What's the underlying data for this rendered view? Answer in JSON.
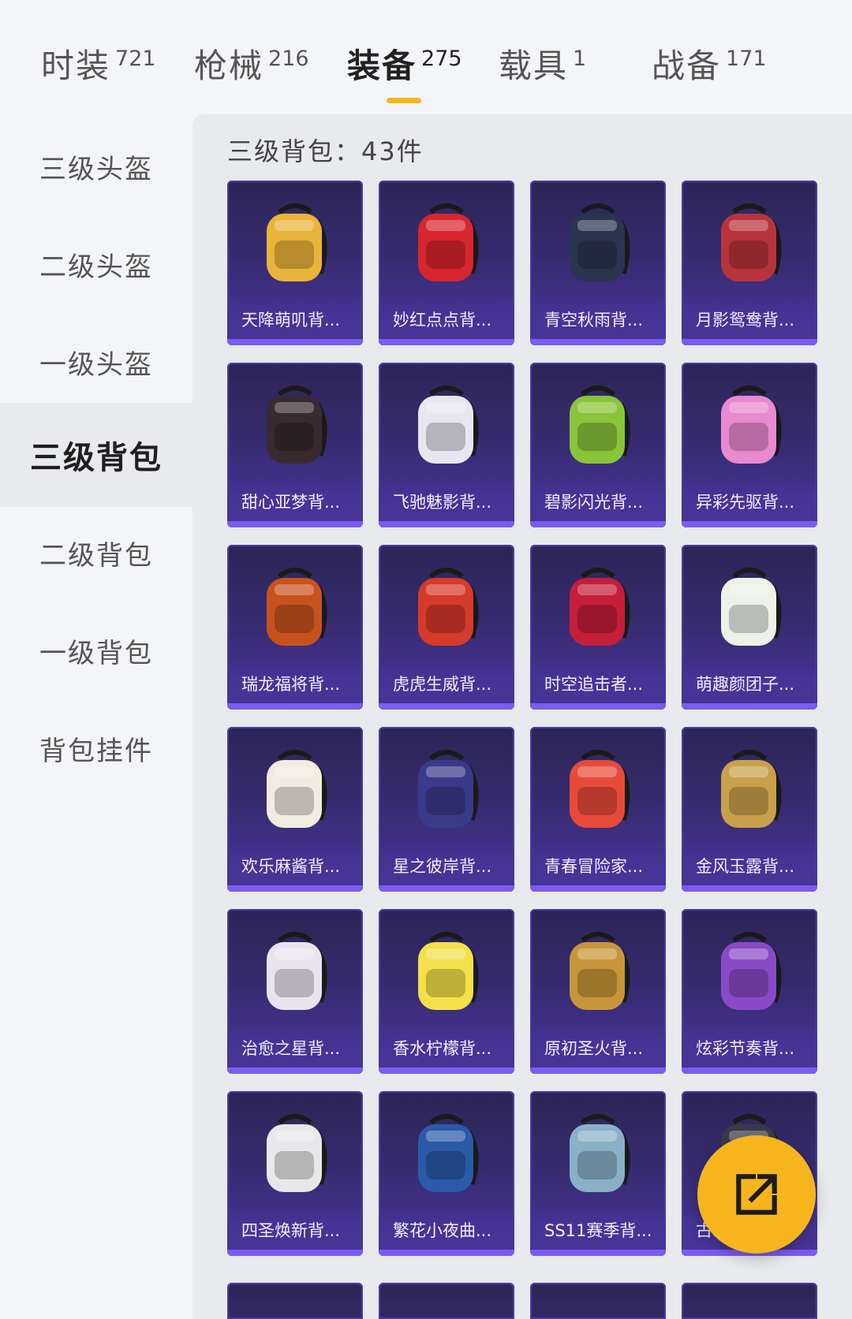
{
  "tabs": [
    {
      "label": "时装",
      "count": "721"
    },
    {
      "label": "枪械",
      "count": "216"
    },
    {
      "label": "装备",
      "count": "275",
      "active": true
    },
    {
      "label": "载具",
      "count": "1"
    },
    {
      "label": "战备",
      "count": "171"
    }
  ],
  "sidebar": {
    "items": [
      {
        "label": "三级头盔"
      },
      {
        "label": "二级头盔"
      },
      {
        "label": "一级头盔"
      },
      {
        "label": "三级背包",
        "active": true
      },
      {
        "label": "二级背包"
      },
      {
        "label": "一级背包"
      },
      {
        "label": "背包挂件"
      }
    ]
  },
  "main": {
    "section_title": "三级背包：43件",
    "items": [
      {
        "name": "天降萌叽背...",
        "icon": "backpack-icon",
        "color": "#e9b43a"
      },
      {
        "name": "妙红点点背...",
        "icon": "backpack-icon",
        "color": "#d8262e"
      },
      {
        "name": "青空秋雨背...",
        "icon": "backpack-icon",
        "color": "#2a3550"
      },
      {
        "name": "月影鸳鸯背...",
        "icon": "backpack-icon",
        "color": "#b8343c"
      },
      {
        "name": "甜心亚梦背...",
        "icon": "backpack-icon",
        "color": "#3a2a30"
      },
      {
        "name": "飞驰魅影背...",
        "icon": "backpack-icon",
        "color": "#e8e6f0"
      },
      {
        "name": "碧影闪光背...",
        "icon": "backpack-icon",
        "color": "#8ac43a"
      },
      {
        "name": "异彩先驱背...",
        "icon": "backpack-icon",
        "color": "#e88ad0"
      },
      {
        "name": "瑞龙福将背...",
        "icon": "backpack-icon",
        "color": "#c8521e"
      },
      {
        "name": "虎虎生威背...",
        "icon": "backpack-icon",
        "color": "#d63a2a"
      },
      {
        "name": "时空追击者...",
        "icon": "backpack-icon",
        "color": "#c41e3a"
      },
      {
        "name": "萌趣颜团子...",
        "icon": "backpack-icon",
        "color": "#eef2e8"
      },
      {
        "name": "欢乐麻酱背...",
        "icon": "backpack-icon",
        "color": "#f1ece0"
      },
      {
        "name": "星之彼岸背...",
        "icon": "backpack-icon",
        "color": "#3a3a8a"
      },
      {
        "name": "青春冒险家...",
        "icon": "backpack-icon",
        "color": "#e84a3a"
      },
      {
        "name": "金风玉露背...",
        "icon": "backpack-icon",
        "color": "#c9a04a"
      },
      {
        "name": "治愈之星背...",
        "icon": "backpack-icon",
        "color": "#e8e4ee"
      },
      {
        "name": "香水柠檬背...",
        "icon": "backpack-icon",
        "color": "#f3e04a"
      },
      {
        "name": "原初圣火背...",
        "icon": "backpack-icon",
        "color": "#c8963a"
      },
      {
        "name": "炫彩节奏背...",
        "icon": "backpack-icon",
        "color": "#8a4ac8"
      },
      {
        "name": "四圣焕新背...",
        "icon": "backpack-icon",
        "color": "#e8e8ea"
      },
      {
        "name": "繁花小夜曲...",
        "icon": "backpack-icon",
        "color": "#2a5aa8"
      },
      {
        "name": "SS11赛季背...",
        "icon": "backpack-icon",
        "color": "#8ab0c8"
      },
      {
        "name": "古...",
        "icon": "backpack-icon",
        "color": "#3a3a48"
      }
    ]
  },
  "fab": {
    "icon": "share-icon",
    "color": "#f6b51c"
  }
}
